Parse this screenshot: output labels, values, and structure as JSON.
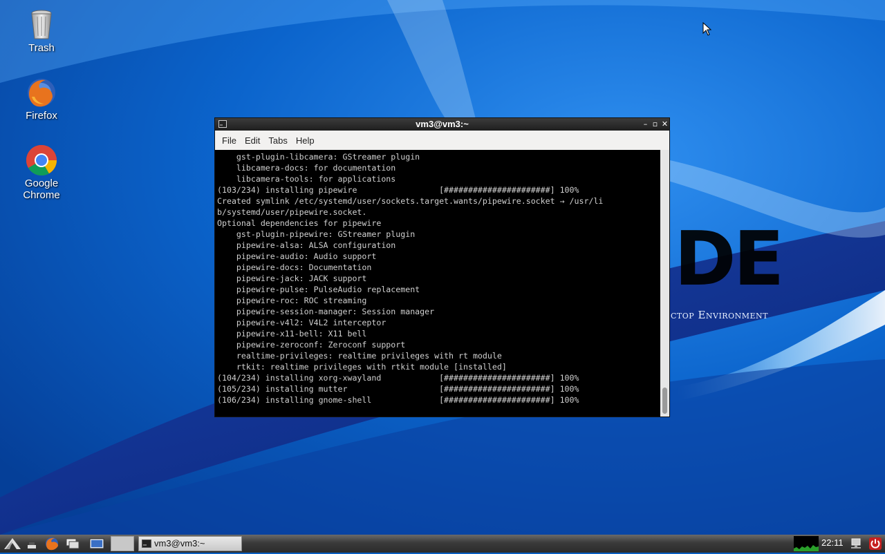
{
  "desktop": {
    "icons": [
      {
        "label": "Trash",
        "icon": "trash-icon"
      },
      {
        "label": "Firefox",
        "icon": "firefox-icon"
      },
      {
        "label": "Google Chrome",
        "icon": "chrome-icon"
      }
    ],
    "wallpaper": {
      "logo_text": "DE",
      "subtitle": "ctop Environment"
    }
  },
  "terminal": {
    "title": "vm3@vm3:~",
    "menu": [
      "File",
      "Edit",
      "Tabs",
      "Help"
    ],
    "lines": [
      "    gst-plugin-libcamera: GStreamer plugin",
      "    libcamera-docs: for documentation",
      "    libcamera-tools: for applications",
      "(103/234) installing pipewire                 [######################] 100%",
      "Created symlink /etc/systemd/user/sockets.target.wants/pipewire.socket → /usr/li",
      "b/systemd/user/pipewire.socket.",
      "Optional dependencies for pipewire",
      "    gst-plugin-pipewire: GStreamer plugin",
      "    pipewire-alsa: ALSA configuration",
      "    pipewire-audio: Audio support",
      "    pipewire-docs: Documentation",
      "    pipewire-jack: JACK support",
      "    pipewire-pulse: PulseAudio replacement",
      "    pipewire-roc: ROC streaming",
      "    pipewire-session-manager: Session manager",
      "    pipewire-v4l2: V4L2 interceptor",
      "    pipewire-x11-bell: X11 bell",
      "    pipewire-zeroconf: Zeroconf support",
      "    realtime-privileges: realtime privileges with rt module",
      "    rtkit: realtime privileges with rtkit module [installed]",
      "(104/234) installing xorg-xwayland            [######################] 100%",
      "(105/234) installing mutter                   [######################] 100%",
      "(106/234) installing gnome-shell              [######################] 100%"
    ]
  },
  "taskbar": {
    "task_label": "vm3@vm3:~",
    "clock": "22:11"
  },
  "colors": {
    "wallpaper_base": "#0a5fc2",
    "terminal_bg": "#000000",
    "terminal_fg": "#d0d0d0"
  }
}
